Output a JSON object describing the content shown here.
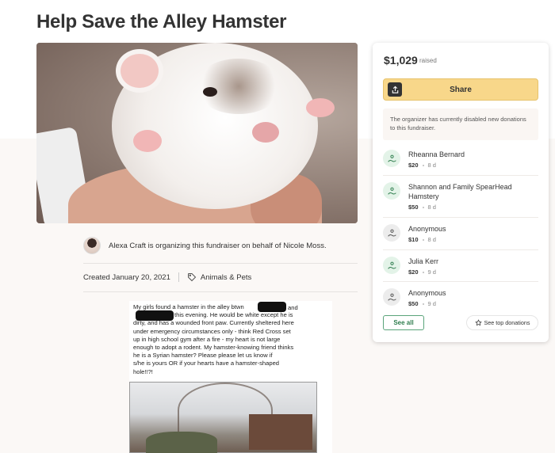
{
  "page": {
    "title": "Help Save the Alley Hamster"
  },
  "organizer": {
    "text": "Alexa Craft is organizing this fundraiser on behalf of Nicole Moss."
  },
  "meta": {
    "created": "Created January 20, 2021",
    "category": "Animals & Pets"
  },
  "story": {
    "lines": [
      "My girls found a hamster in the alley btwn",
      "this evening. He would be white except he is",
      "dirty, and has a wounded front paw. Currently sheltered here",
      "under emergency circumstances only - think Red Cross set",
      "up in high school gym after a fire - my heart is not large",
      "enough to adopt a rodent. My hamster-knowing friend thinks",
      "he is a Syrian hamster? Please please let us know if",
      "s/he is yours OR if your hearts have a hamster-shaped",
      "hole!!?!"
    ],
    "and_word": "and"
  },
  "sidebar": {
    "amount": "$1,029",
    "raised_label": "raised",
    "share_label": "Share",
    "notice": "The organizer has currently disabled new donations to this fundraiser.",
    "donations": [
      {
        "name": "Rheanna Bernard",
        "amount": "$20",
        "time": "8 d",
        "avatar": "green"
      },
      {
        "name": "Shannon and Family SpearHead Hamstery",
        "amount": "$50",
        "time": "8 d",
        "avatar": "green"
      },
      {
        "name": "Anonymous",
        "amount": "$10",
        "time": "8 d",
        "avatar": "grey"
      },
      {
        "name": "Julia Kerr",
        "amount": "$20",
        "time": "9 d",
        "avatar": "green"
      },
      {
        "name": "Anonymous",
        "amount": "$50",
        "time": "9 d",
        "avatar": "grey"
      }
    ],
    "see_all_label": "See all",
    "see_top_label": "See top donations"
  },
  "colors": {
    "share_button": "#f8d78a",
    "see_all_border": "#5aa47a",
    "avatar_green": "#e3f3e8"
  }
}
